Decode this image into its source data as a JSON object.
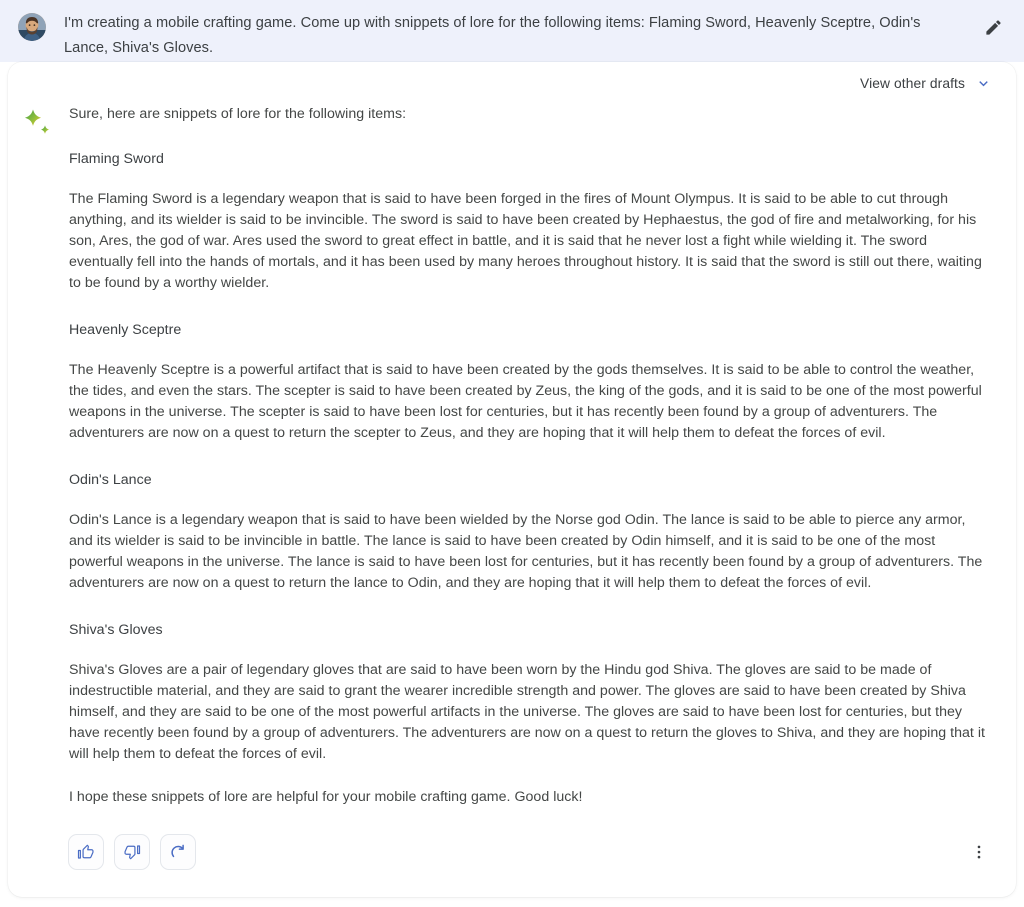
{
  "prompt": {
    "text": "I'm creating a mobile crafting game. Come up with snippets of lore for the following items: Flaming Sword, Heavenly Sceptre, Odin's Lance, Shiva's Gloves.",
    "edit_label": "Edit prompt"
  },
  "response": {
    "drafts_label": "View other drafts",
    "intro": "Sure, here are snippets of lore for the following items:",
    "items": [
      {
        "heading": "Flaming Sword",
        "body": "The Flaming Sword is a legendary weapon that is said to have been forged in the fires of Mount Olympus. It is said to be able to cut through anything, and its wielder is said to be invincible. The sword is said to have been created by Hephaestus, the god of fire and metalworking, for his son, Ares, the god of war. Ares used the sword to great effect in battle, and it is said that he never lost a fight while wielding it. The sword eventually fell into the hands of mortals, and it has been used by many heroes throughout history. It is said that the sword is still out there, waiting to be found by a worthy wielder."
      },
      {
        "heading": "Heavenly Sceptre",
        "body": "The Heavenly Sceptre is a powerful artifact that is said to have been created by the gods themselves. It is said to be able to control the weather, the tides, and even the stars. The scepter is said to have been created by Zeus, the king of the gods, and it is said to be one of the most powerful weapons in the universe. The scepter is said to have been lost for centuries, but it has recently been found by a group of adventurers. The adventurers are now on a quest to return the scepter to Zeus, and they are hoping that it will help them to defeat the forces of evil."
      },
      {
        "heading": "Odin's Lance",
        "body": "Odin's Lance is a legendary weapon that is said to have been wielded by the Norse god Odin. The lance is said to be able to pierce any armor, and its wielder is said to be invincible in battle. The lance is said to have been created by Odin himself, and it is said to be one of the most powerful weapons in the universe. The lance is said to have been lost for centuries, but it has recently been found by a group of adventurers. The adventurers are now on a quest to return the lance to Odin, and they are hoping that it will help them to defeat the forces of evil."
      },
      {
        "heading": "Shiva's Gloves",
        "body": "Shiva's Gloves are a pair of legendary gloves that are said to have been worn by the Hindu god Shiva. The gloves are said to be made of indestructible material, and they are said to grant the wearer incredible strength and power. The gloves are said to have been created by Shiva himself, and they are said to be one of the most powerful artifacts in the universe. The gloves are said to have been lost for centuries, but they have recently been found by a group of adventurers. The adventurers are now on a quest to return the gloves to Shiva, and they are hoping that it will help them to defeat the forces of evil."
      }
    ],
    "outro": "I hope these snippets of lore are helpful for your mobile crafting game. Good luck!"
  },
  "actions": {
    "thumbs_up_label": "Good response",
    "thumbs_down_label": "Bad response",
    "regenerate_label": "Regenerate draft",
    "more_label": "More options"
  },
  "colors": {
    "prompt_background": "#eef1fb",
    "card_background": "#ffffff",
    "accent_blue": "#4a6cc4",
    "text_primary": "#3c4043",
    "text_body": "#444746",
    "sparkle_green": "#4e9e4a",
    "sparkle_yellow": "#f0c22e"
  }
}
